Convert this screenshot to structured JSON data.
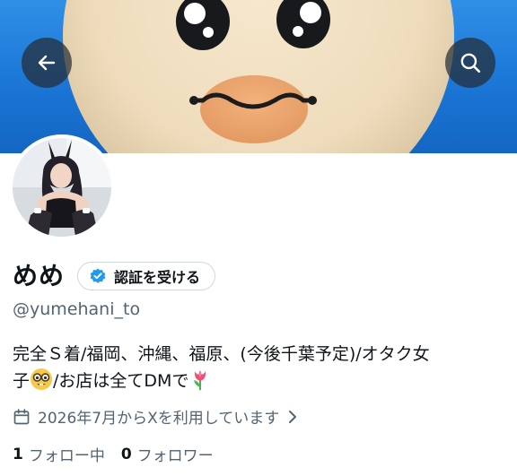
{
  "header": {
    "back_icon": "arrow-left-icon",
    "search_icon": "search-icon",
    "button_color": "#262c34",
    "banner_color": "#1b76d6"
  },
  "profile": {
    "display_name": "めめ",
    "verify_button_label": "認証を受ける",
    "verify_icon": "verified-badge-icon",
    "handle": "@yumehani_to",
    "bio_line1": "完全Ｓ着/福岡、沖縄、福原、(今後千葉予定)/オタク女",
    "bio_line2_a": "子",
    "bio_line2_b": "/お店は全てDMで",
    "bio_emojis": [
      "nerd-face-emoji",
      "tulip-emoji"
    ],
    "joined_text": "2026年7月からXを利用しています",
    "following_count": "1",
    "following_label": "フォロー中",
    "followers_count": "0",
    "followers_label": "フォロワー"
  },
  "colors": {
    "accent": "#1d9bf0",
    "text_primary": "#0f1419",
    "text_secondary": "#536471",
    "border": "#cfd9de"
  }
}
